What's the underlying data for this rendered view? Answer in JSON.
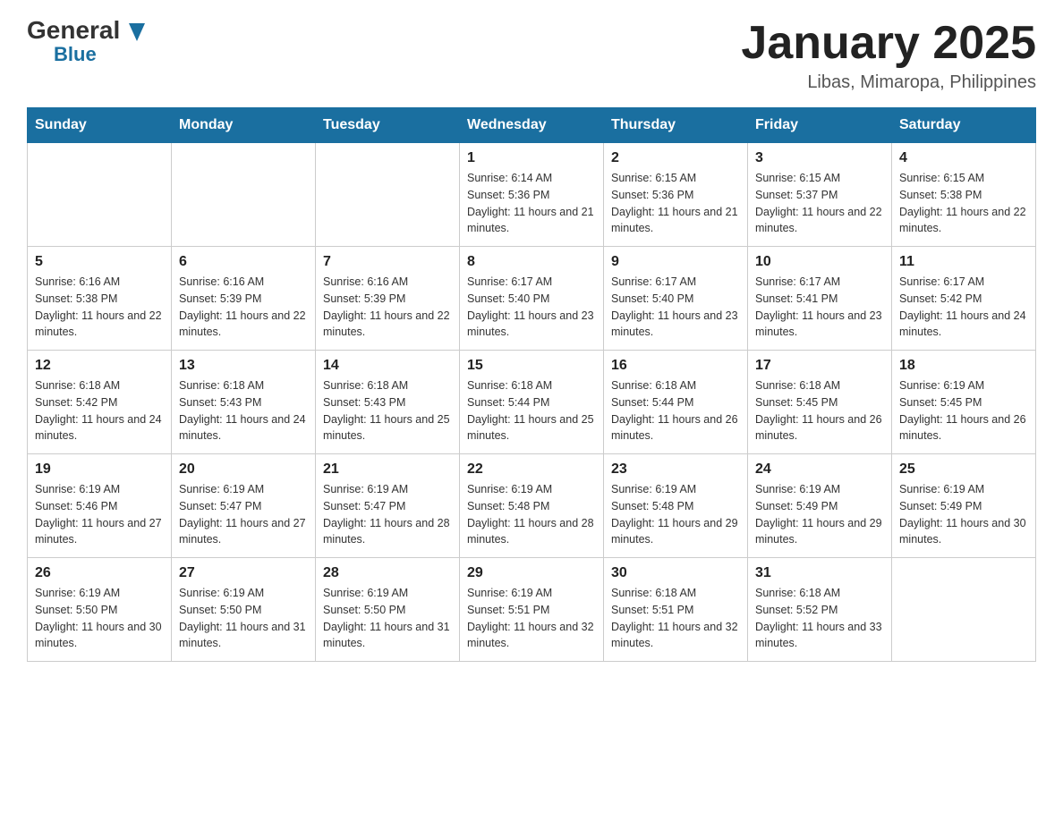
{
  "logo": {
    "general": "General",
    "blue": "Blue",
    "arrow": "▼"
  },
  "title": "January 2025",
  "location": "Libas, Mimaropa, Philippines",
  "days_of_week": [
    "Sunday",
    "Monday",
    "Tuesday",
    "Wednesday",
    "Thursday",
    "Friday",
    "Saturday"
  ],
  "weeks": [
    [
      null,
      null,
      null,
      {
        "num": "1",
        "sunrise": "6:14 AM",
        "sunset": "5:36 PM",
        "daylight": "11 hours and 21 minutes."
      },
      {
        "num": "2",
        "sunrise": "6:15 AM",
        "sunset": "5:36 PM",
        "daylight": "11 hours and 21 minutes."
      },
      {
        "num": "3",
        "sunrise": "6:15 AM",
        "sunset": "5:37 PM",
        "daylight": "11 hours and 22 minutes."
      },
      {
        "num": "4",
        "sunrise": "6:15 AM",
        "sunset": "5:38 PM",
        "daylight": "11 hours and 22 minutes."
      }
    ],
    [
      {
        "num": "5",
        "sunrise": "6:16 AM",
        "sunset": "5:38 PM",
        "daylight": "11 hours and 22 minutes."
      },
      {
        "num": "6",
        "sunrise": "6:16 AM",
        "sunset": "5:39 PM",
        "daylight": "11 hours and 22 minutes."
      },
      {
        "num": "7",
        "sunrise": "6:16 AM",
        "sunset": "5:39 PM",
        "daylight": "11 hours and 22 minutes."
      },
      {
        "num": "8",
        "sunrise": "6:17 AM",
        "sunset": "5:40 PM",
        "daylight": "11 hours and 23 minutes."
      },
      {
        "num": "9",
        "sunrise": "6:17 AM",
        "sunset": "5:40 PM",
        "daylight": "11 hours and 23 minutes."
      },
      {
        "num": "10",
        "sunrise": "6:17 AM",
        "sunset": "5:41 PM",
        "daylight": "11 hours and 23 minutes."
      },
      {
        "num": "11",
        "sunrise": "6:17 AM",
        "sunset": "5:42 PM",
        "daylight": "11 hours and 24 minutes."
      }
    ],
    [
      {
        "num": "12",
        "sunrise": "6:18 AM",
        "sunset": "5:42 PM",
        "daylight": "11 hours and 24 minutes."
      },
      {
        "num": "13",
        "sunrise": "6:18 AM",
        "sunset": "5:43 PM",
        "daylight": "11 hours and 24 minutes."
      },
      {
        "num": "14",
        "sunrise": "6:18 AM",
        "sunset": "5:43 PM",
        "daylight": "11 hours and 25 minutes."
      },
      {
        "num": "15",
        "sunrise": "6:18 AM",
        "sunset": "5:44 PM",
        "daylight": "11 hours and 25 minutes."
      },
      {
        "num": "16",
        "sunrise": "6:18 AM",
        "sunset": "5:44 PM",
        "daylight": "11 hours and 26 minutes."
      },
      {
        "num": "17",
        "sunrise": "6:18 AM",
        "sunset": "5:45 PM",
        "daylight": "11 hours and 26 minutes."
      },
      {
        "num": "18",
        "sunrise": "6:19 AM",
        "sunset": "5:45 PM",
        "daylight": "11 hours and 26 minutes."
      }
    ],
    [
      {
        "num": "19",
        "sunrise": "6:19 AM",
        "sunset": "5:46 PM",
        "daylight": "11 hours and 27 minutes."
      },
      {
        "num": "20",
        "sunrise": "6:19 AM",
        "sunset": "5:47 PM",
        "daylight": "11 hours and 27 minutes."
      },
      {
        "num": "21",
        "sunrise": "6:19 AM",
        "sunset": "5:47 PM",
        "daylight": "11 hours and 28 minutes."
      },
      {
        "num": "22",
        "sunrise": "6:19 AM",
        "sunset": "5:48 PM",
        "daylight": "11 hours and 28 minutes."
      },
      {
        "num": "23",
        "sunrise": "6:19 AM",
        "sunset": "5:48 PM",
        "daylight": "11 hours and 29 minutes."
      },
      {
        "num": "24",
        "sunrise": "6:19 AM",
        "sunset": "5:49 PM",
        "daylight": "11 hours and 29 minutes."
      },
      {
        "num": "25",
        "sunrise": "6:19 AM",
        "sunset": "5:49 PM",
        "daylight": "11 hours and 30 minutes."
      }
    ],
    [
      {
        "num": "26",
        "sunrise": "6:19 AM",
        "sunset": "5:50 PM",
        "daylight": "11 hours and 30 minutes."
      },
      {
        "num": "27",
        "sunrise": "6:19 AM",
        "sunset": "5:50 PM",
        "daylight": "11 hours and 31 minutes."
      },
      {
        "num": "28",
        "sunrise": "6:19 AM",
        "sunset": "5:50 PM",
        "daylight": "11 hours and 31 minutes."
      },
      {
        "num": "29",
        "sunrise": "6:19 AM",
        "sunset": "5:51 PM",
        "daylight": "11 hours and 32 minutes."
      },
      {
        "num": "30",
        "sunrise": "6:18 AM",
        "sunset": "5:51 PM",
        "daylight": "11 hours and 32 minutes."
      },
      {
        "num": "31",
        "sunrise": "6:18 AM",
        "sunset": "5:52 PM",
        "daylight": "11 hours and 33 minutes."
      },
      null
    ]
  ]
}
